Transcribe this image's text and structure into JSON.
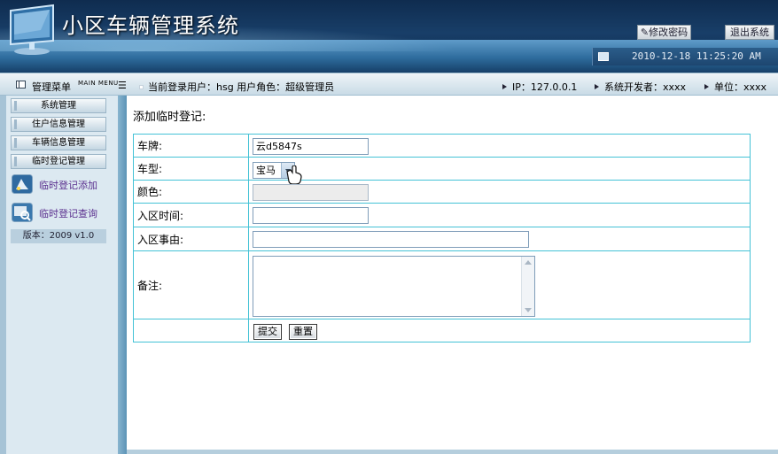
{
  "header": {
    "title": "小区车辆管理系统",
    "change_password": "修改密码",
    "logout": "退出系统",
    "datetime": "2010-12-18 11:25:20 AM"
  },
  "infobar": {
    "menu_title": "管理菜单",
    "menu_subtitle": "MAIN MENU",
    "separator": "☰",
    "current_user": "当前登录用户：hsg  用户角色：超级管理员",
    "ip": "IP：127.0.0.1",
    "developer": "系统开发者：xxxx",
    "unit": "单位：xxxx"
  },
  "sidebar": {
    "menus": [
      {
        "label": "系统管理"
      },
      {
        "label": "住户信息管理"
      },
      {
        "label": "车辆信息管理"
      },
      {
        "label": "临时登记管理"
      }
    ],
    "links": [
      {
        "label": "临时登记添加",
        "icon": "vehicle-add-icon"
      },
      {
        "label": "临时登记查询",
        "icon": "search-record-icon"
      }
    ],
    "version": "版本：2009 v1.0"
  },
  "form": {
    "title": "添加临时登记:",
    "plate_label": "车牌:",
    "plate_value": "云d5847s",
    "type_label": "车型:",
    "type_value": "宝马",
    "color_label": "颜色:",
    "color_value": "",
    "time_label": "入区时间:",
    "time_value": "",
    "reason_label": "入区事由:",
    "reason_value": "",
    "remark_label": "备注:",
    "remark_value": "",
    "submit": "提交",
    "reset": "重置"
  },
  "colors": {
    "header_bg": "#183e68",
    "table_border": "#44c2d6",
    "link": "#5a2f8e",
    "sidebar_bg": "#dce9f1"
  }
}
